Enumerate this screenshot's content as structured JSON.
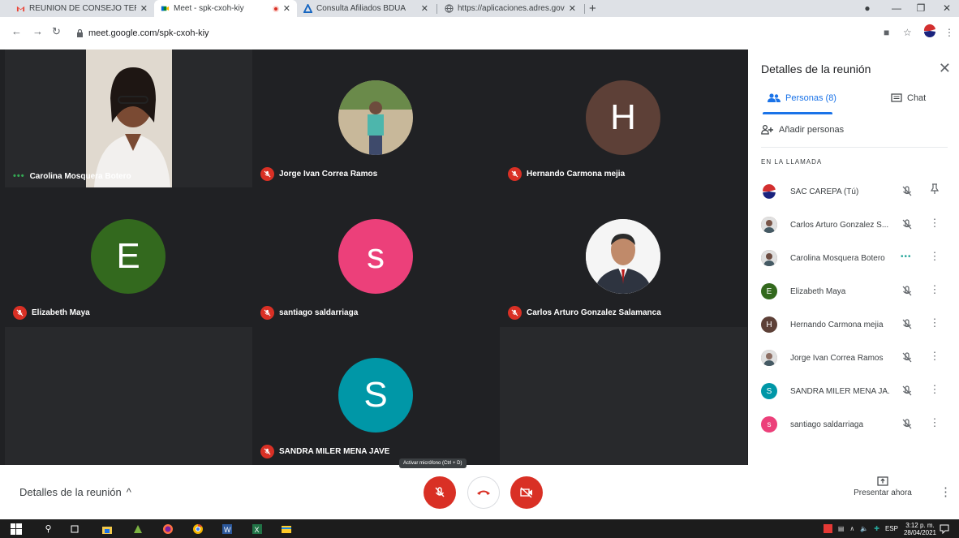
{
  "browser": {
    "tabs": [
      {
        "title": "REUNION DE CONSEJO TERRITORIAL",
        "favicon": "gmail-icon"
      },
      {
        "title": "Meet - spk-cxoh-kiy",
        "favicon": "meet-icon",
        "active": true
      },
      {
        "title": "Consulta Afiliados BDUA",
        "favicon": "adres-icon"
      },
      {
        "title": "https://aplicaciones.adres.gov.co",
        "favicon": "globe-icon"
      }
    ],
    "url": "meet.google.com/spk-cxoh-kiy",
    "new_tab": "+"
  },
  "meet": {
    "tiles": [
      {
        "name": "Carolina Mosquera Botero",
        "kind": "video",
        "status": "speaking"
      },
      {
        "name": "Jorge Ivan Correa Ramos",
        "kind": "photo",
        "status": "muted"
      },
      {
        "name": "Hernando Carmona mejia",
        "kind": "letter",
        "letter": "H",
        "color": "#5d4037",
        "status": "muted"
      },
      {
        "name": "Elizabeth Maya",
        "kind": "letter",
        "letter": "E",
        "color": "#33691e",
        "status": "muted"
      },
      {
        "name": "santiago saldarriaga",
        "kind": "letter",
        "letter": "s",
        "color": "#ec407a",
        "status": "muted"
      },
      {
        "name": "Carlos Arturo Gonzalez Salamanca",
        "kind": "photo2",
        "status": "muted"
      },
      {
        "name": "SANDRA MILER MENA JAVE",
        "kind": "letter",
        "letter": "S",
        "color": "#0097a7",
        "status": "muted"
      }
    ]
  },
  "panel": {
    "title": "Detalles de la reunión",
    "tab_people": "Personas (8)",
    "tab_chat": "Chat",
    "add_people": "Añadir personas",
    "section": "EN LA LLAMADA",
    "people": [
      {
        "name": "SAC CAREPA (Tú)",
        "avatar": "logo",
        "color": "#1a237e",
        "action": "pin"
      },
      {
        "name": "Carlos Arturo Gonzalez S...",
        "avatar": "photo",
        "color": "#795548",
        "action": "more"
      },
      {
        "name": "Carolina Mosquera Botero",
        "avatar": "photo",
        "color": "#6d4c41",
        "action": "more",
        "speaking": true
      },
      {
        "name": "Elizabeth Maya",
        "avatar": "E",
        "color": "#33691e",
        "action": "more"
      },
      {
        "name": "Hernando Carmona mejia",
        "avatar": "H",
        "color": "#5d4037",
        "action": "more"
      },
      {
        "name": "Jorge Ivan Correa Ramos",
        "avatar": "photo",
        "color": "#8d6e63",
        "action": "more"
      },
      {
        "name": "SANDRA MILER MENA JA...",
        "avatar": "S",
        "color": "#0097a7",
        "action": "more"
      },
      {
        "name": "santiago saldarriaga",
        "avatar": "s",
        "color": "#ec407a",
        "action": "more"
      }
    ]
  },
  "bottom": {
    "details": "Detalles de la reunión",
    "tooltip": "Activar micrófono (Ctrl + D)",
    "present": "Presentar ahora"
  },
  "taskbar": {
    "lang": "ESP",
    "time": "3:12 p. m.",
    "date": "28/04/2021"
  },
  "colors": {
    "accent": "#1a73e8",
    "danger": "#d93025",
    "stage": "#202124"
  }
}
